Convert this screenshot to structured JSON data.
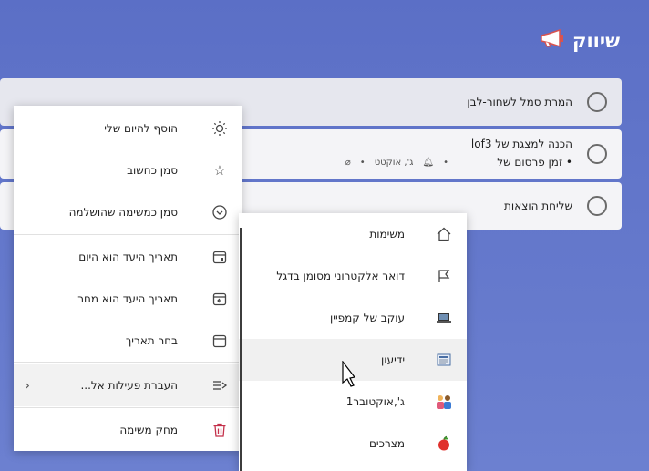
{
  "list": {
    "title": "שיווק",
    "icon": "megaphone-icon"
  },
  "tasks": [
    {
      "title": "המרת סמל לשחור-לבן"
    },
    {
      "title": "הכנה למצגת של lof3",
      "line2": "• זמן פרסום של",
      "meta_date": "ג', אוקטט",
      "meta_dot": "•"
    },
    {
      "title": "שליחת הוצאות"
    }
  ],
  "menu": {
    "items": [
      {
        "label": "הוסף להיום שלי",
        "icon": "sun-icon"
      },
      {
        "label": "סמן כחשוב",
        "icon": "star-icon"
      },
      {
        "label": "סמן כמשימה שהושלמה",
        "icon": "check-circle-icon"
      },
      {
        "label": "תאריך היעד הוא היום",
        "icon": "calendar-today-icon"
      },
      {
        "label": "תאריך היעד הוא מחר",
        "icon": "calendar-tomorrow-icon"
      },
      {
        "label": "בחר תאריך",
        "icon": "calendar-icon"
      },
      {
        "label": "העברת פעילות אל...",
        "icon": "move-list-icon"
      },
      {
        "label": "מחק משימה",
        "icon": "trash-icon"
      }
    ]
  },
  "submenu": {
    "items": [
      {
        "label": "משימות",
        "icon": "home-icon"
      },
      {
        "label": "דואר אלקטרוני מסומן בדגל",
        "icon": "flag-icon"
      },
      {
        "label": "עוקב של קמפיין",
        "icon": "laptop-icon"
      },
      {
        "label": "ידיעון",
        "icon": "newspaper-icon"
      },
      {
        "label": "ג',אוקטובר1",
        "icon": "people-icon"
      },
      {
        "label": "מצרכים",
        "icon": "apple-icon"
      }
    ]
  },
  "colors": {
    "background": "#5b6fc6",
    "delete": "#c4314b"
  }
}
